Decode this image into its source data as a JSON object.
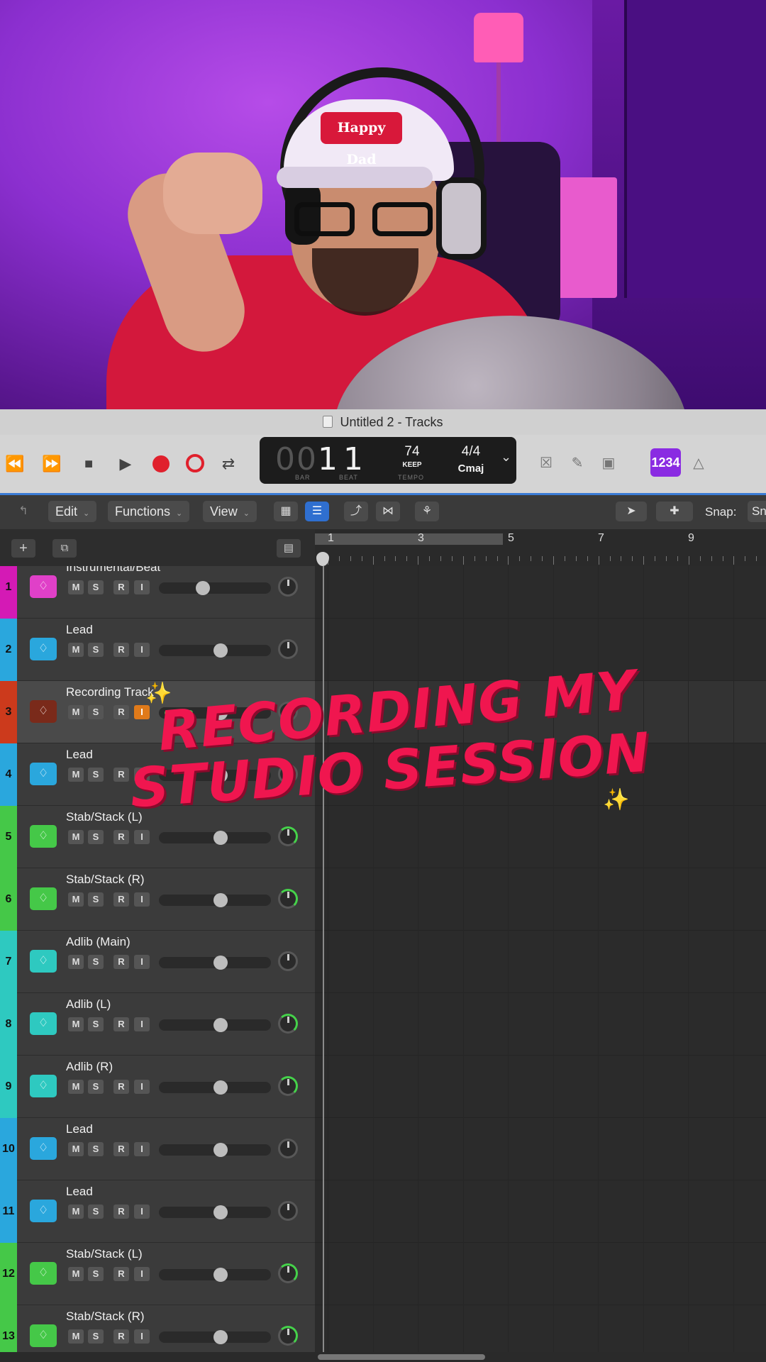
{
  "window": {
    "title": "Untitled 2 - Tracks"
  },
  "transport": {
    "bar_dim": "00",
    "bar": "1",
    "beat": "1",
    "bar_label": "BAR",
    "beat_label": "BEAT",
    "tempo": "74",
    "tempo_mode": "KEEP",
    "tempo_label": "TEMPO",
    "time_signature": "4/4",
    "key": "Cmaj",
    "count_in": "1234"
  },
  "menu": {
    "edit": "Edit",
    "functions": "Functions",
    "view": "View",
    "snap_label": "Snap:",
    "snap_value": "Sn"
  },
  "ruler": {
    "bars": [
      "1",
      "3",
      "5",
      "7",
      "9"
    ]
  },
  "tracks": [
    {
      "num": "1",
      "name": "Instrumental/Beat",
      "color": "#d41ab5",
      "icon_color": "#e040c8",
      "fader": 0.38,
      "pan": "center"
    },
    {
      "num": "2",
      "name": "Lead",
      "color": "#2aa7dd",
      "icon_color": "#2aa7dd",
      "fader": 0.56,
      "pan": "center"
    },
    {
      "num": "3",
      "name": "Recording Track",
      "color": "#cc3a1c",
      "icon_color": "#7a2a1a",
      "fader": 0.56,
      "pan": "center",
      "input_monitor": true,
      "selected": true
    },
    {
      "num": "4",
      "name": "Lead",
      "color": "#2aa7dd",
      "icon_color": "#2aa7dd",
      "fader": 0.56,
      "pan": "center"
    },
    {
      "num": "5",
      "name": "Stab/Stack (L)",
      "color": "#45c848",
      "icon_color": "#45c848",
      "fader": 0.56,
      "pan": "left"
    },
    {
      "num": "6",
      "name": "Stab/Stack (R)",
      "color": "#45c848",
      "icon_color": "#45c848",
      "fader": 0.56,
      "pan": "right"
    },
    {
      "num": "7",
      "name": "Adlib (Main)",
      "color": "#2ec9c0",
      "icon_color": "#2ec9c0",
      "fader": 0.56,
      "pan": "center"
    },
    {
      "num": "8",
      "name": "Adlib (L)",
      "color": "#2ec9c0",
      "icon_color": "#2ec9c0",
      "fader": 0.56,
      "pan": "left"
    },
    {
      "num": "9",
      "name": "Adlib (R)",
      "color": "#2ec9c0",
      "icon_color": "#2ec9c0",
      "fader": 0.56,
      "pan": "right"
    },
    {
      "num": "10",
      "name": "Lead",
      "color": "#2aa7dd",
      "icon_color": "#2aa7dd",
      "fader": 0.56,
      "pan": "center"
    },
    {
      "num": "11",
      "name": "Lead",
      "color": "#2aa7dd",
      "icon_color": "#2aa7dd",
      "fader": 0.56,
      "pan": "center"
    },
    {
      "num": "12",
      "name": "Stab/Stack (L)",
      "color": "#45c848",
      "icon_color": "#45c848",
      "fader": 0.56,
      "pan": "left"
    },
    {
      "num": "13",
      "name": "Stab/Stack (R)",
      "color": "#45c848",
      "icon_color": "#45c848",
      "fader": 0.56,
      "pan": "right"
    }
  ],
  "track_buttons": {
    "mute": "M",
    "solo": "S",
    "record": "R",
    "input": "I"
  },
  "overlay": {
    "line1": "RECORDING MY",
    "line2": "STUDIO SESSION"
  },
  "cap_logo": "Happy Dad"
}
